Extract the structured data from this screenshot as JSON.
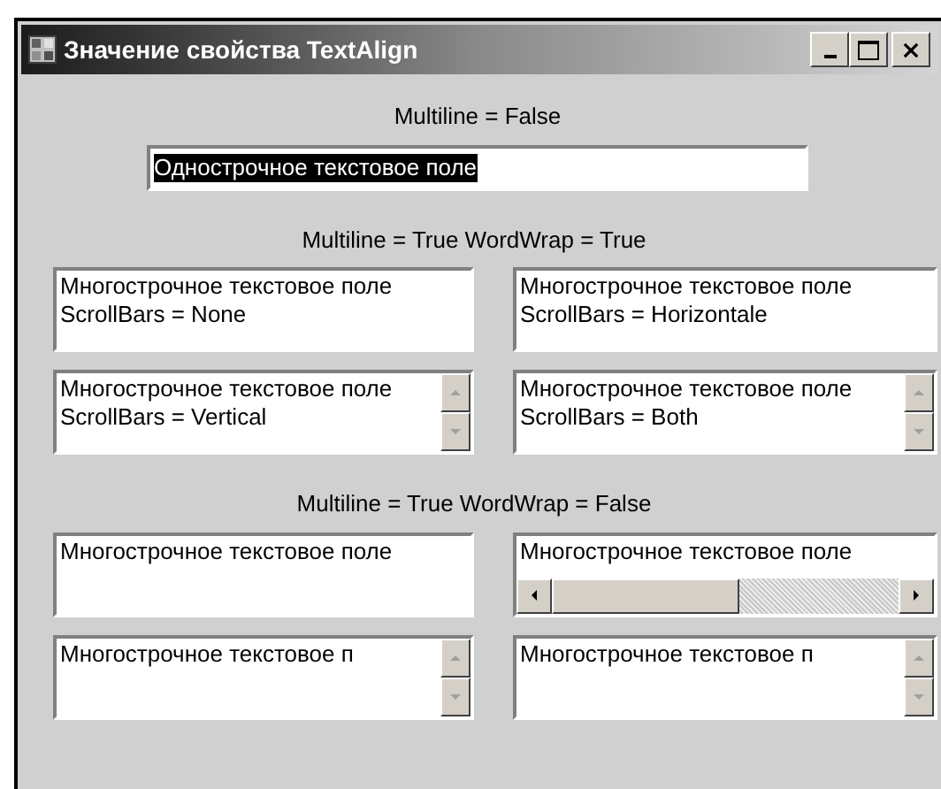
{
  "window": {
    "title": "Значение свойства TextAlign"
  },
  "single": {
    "label": "Multiline = False",
    "value": "Однострочное текстовое поле",
    "text_selected": true
  },
  "sections": [
    {
      "label": "Multiline = True WordWrap = True",
      "boxes": [
        {
          "kind": "plain",
          "text": "Многострочное текстовое поле ScrollBars = None"
        },
        {
          "kind": "plain",
          "text": "Многострочное текстовое поле ScrollBars = Horizontale"
        },
        {
          "kind": "vscroll",
          "text": "Многострочное текстовое поле ScrollBars = Vertical"
        },
        {
          "kind": "vscroll",
          "text": "Многострочное текстовое поле ScrollBars = Both"
        }
      ]
    },
    {
      "label": "Multiline = True WordWrap = False",
      "boxes": [
        {
          "kind": "plain",
          "text": "Многострочное текстовое поле"
        },
        {
          "kind": "hscroll",
          "text": "Многострочное текстовое поле"
        },
        {
          "kind": "vscroll",
          "text": "Многострочное текстовое п"
        },
        {
          "kind": "vscroll",
          "text": "Многострочное текстовое п"
        }
      ]
    }
  ]
}
